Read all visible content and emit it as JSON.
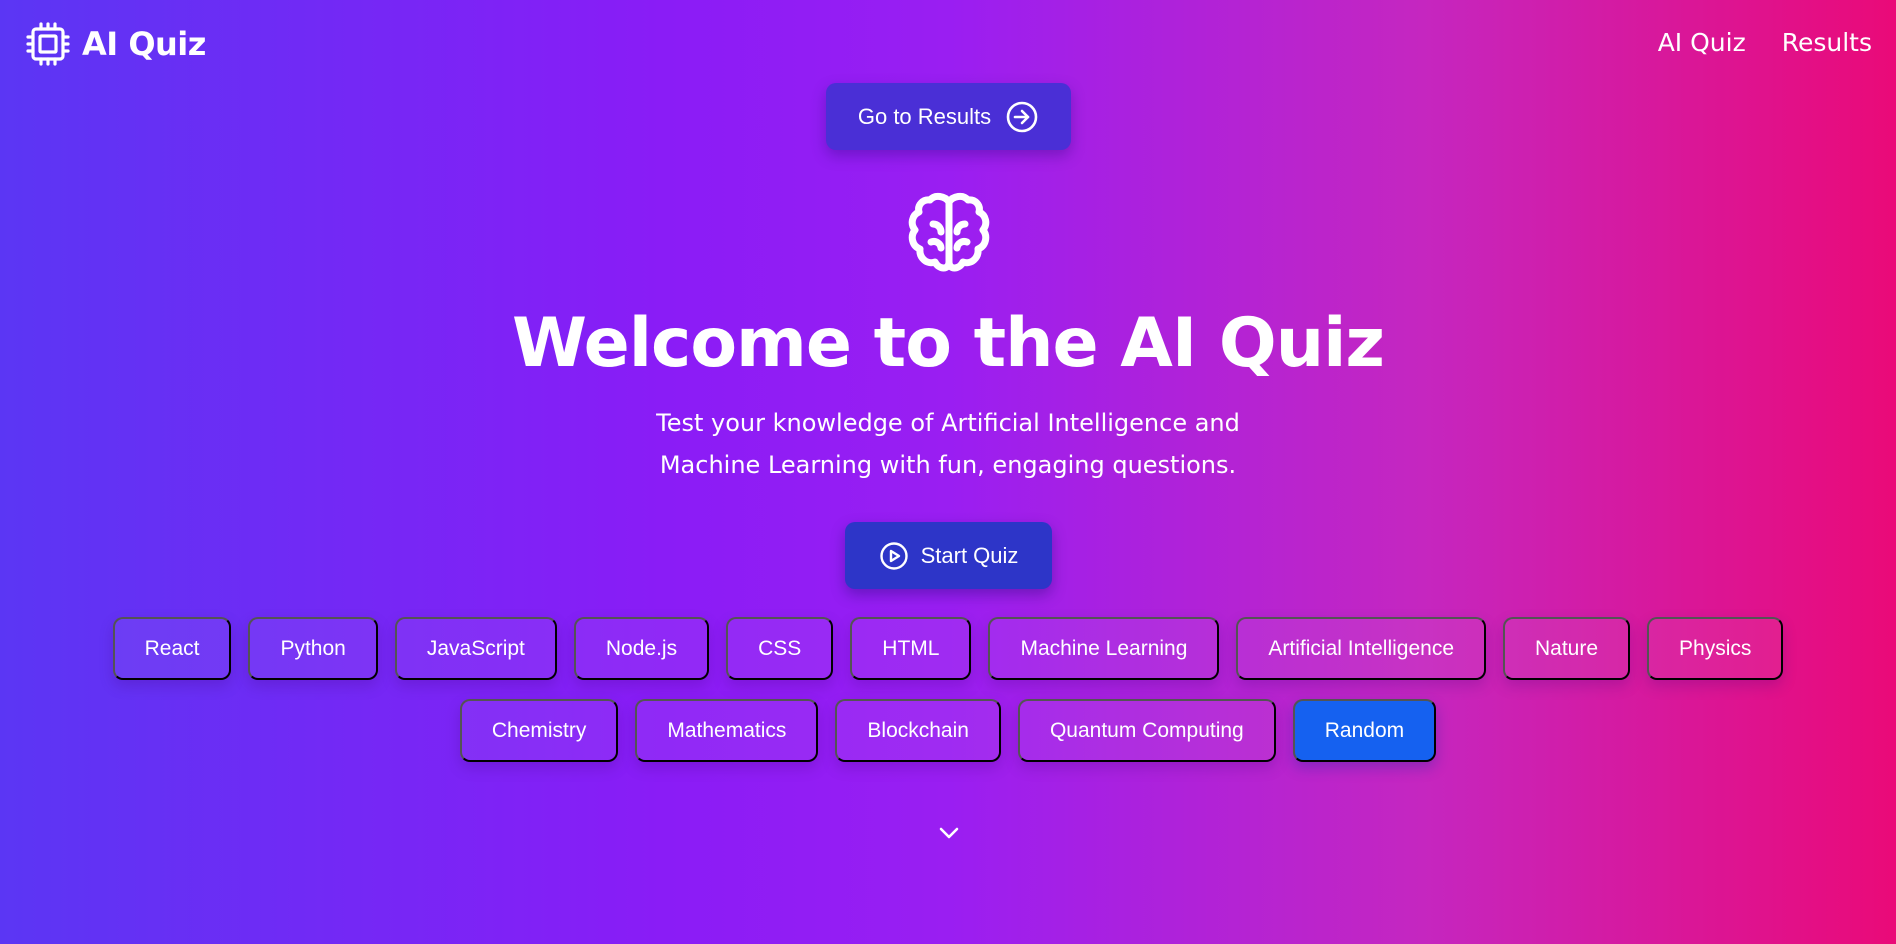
{
  "header": {
    "brand_name": "AI Quiz",
    "brand_icon": "cpu-chip-icon",
    "nav": [
      "AI Quiz",
      "Results"
    ]
  },
  "hero": {
    "go_results_label": "Go to Results",
    "go_results_icon": "arrow-right-circle-icon",
    "hero_icon": "brain-icon",
    "title": "Welcome to the AI Quiz",
    "subtitle_line1": "Test your knowledge of Artificial Intelligence and",
    "subtitle_line2": "Machine Learning with fun, engaging questions.",
    "start_label": "Start Quiz",
    "start_icon": "play-circle-icon",
    "scroll_icon": "chevron-down-icon"
  },
  "categories_row1": [
    "React",
    "Python",
    "JavaScript",
    "Node.js",
    "CSS",
    "HTML",
    "Machine Learning",
    "Artificial Intelligence",
    "Nature",
    "Physics"
  ],
  "categories_row2": [
    "Chemistry",
    "Mathematics",
    "Blockchain",
    "Quantum Computing",
    "Random"
  ],
  "selected_category": "Random",
  "colors": {
    "gradient_start": "#5b36f4",
    "gradient_mid": "#9a1ef2",
    "gradient_end": "#ea0a78",
    "go_results_bg": "#4a2fd6",
    "start_bg": "#2d35c8",
    "active_chip_bg": "#1561f0"
  }
}
